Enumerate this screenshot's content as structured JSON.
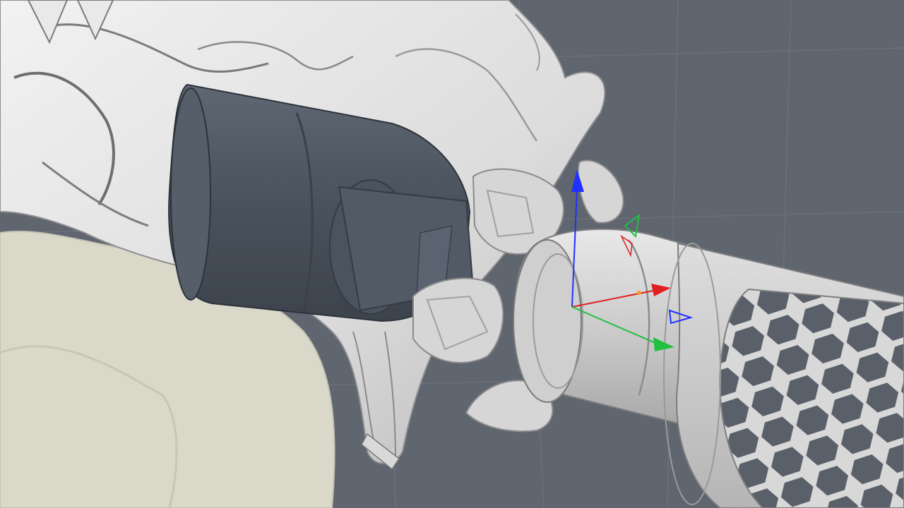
{
  "viewport": {
    "kind": "3d-perspective-viewport",
    "background_color": "#5f6670",
    "grid_color": "#6b737d",
    "axis_colors": {
      "x": "#e02020",
      "y": "#20c040",
      "z": "#2030ff"
    },
    "objects": [
      {
        "name": "vertebra-mesh",
        "color": "#e4e4e4"
      },
      {
        "name": "pelvis-mesh",
        "color": "#d9d8c9"
      },
      {
        "name": "screw-head",
        "color": "#4f5763"
      },
      {
        "name": "holder-tool",
        "color": "#cfcfcf"
      },
      {
        "name": "honeycomb-sleeve",
        "color": "#d3d3d3"
      }
    ],
    "gizmo": {
      "kind": "move-gizmo",
      "axes": [
        "x",
        "y",
        "z"
      ]
    }
  }
}
